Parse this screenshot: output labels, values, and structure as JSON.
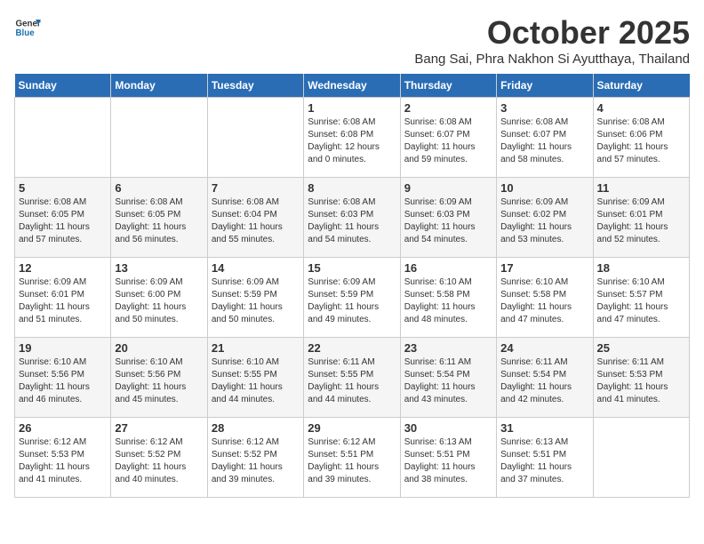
{
  "header": {
    "logo_general": "General",
    "logo_blue": "Blue",
    "month_title": "October 2025",
    "subtitle": "Bang Sai, Phra Nakhon Si Ayutthaya, Thailand"
  },
  "days_of_week": [
    "Sunday",
    "Monday",
    "Tuesday",
    "Wednesday",
    "Thursday",
    "Friday",
    "Saturday"
  ],
  "weeks": [
    [
      {
        "day": "",
        "info": ""
      },
      {
        "day": "",
        "info": ""
      },
      {
        "day": "",
        "info": ""
      },
      {
        "day": "1",
        "info": "Sunrise: 6:08 AM\nSunset: 6:08 PM\nDaylight: 12 hours\nand 0 minutes."
      },
      {
        "day": "2",
        "info": "Sunrise: 6:08 AM\nSunset: 6:07 PM\nDaylight: 11 hours\nand 59 minutes."
      },
      {
        "day": "3",
        "info": "Sunrise: 6:08 AM\nSunset: 6:07 PM\nDaylight: 11 hours\nand 58 minutes."
      },
      {
        "day": "4",
        "info": "Sunrise: 6:08 AM\nSunset: 6:06 PM\nDaylight: 11 hours\nand 57 minutes."
      }
    ],
    [
      {
        "day": "5",
        "info": "Sunrise: 6:08 AM\nSunset: 6:05 PM\nDaylight: 11 hours\nand 57 minutes."
      },
      {
        "day": "6",
        "info": "Sunrise: 6:08 AM\nSunset: 6:05 PM\nDaylight: 11 hours\nand 56 minutes."
      },
      {
        "day": "7",
        "info": "Sunrise: 6:08 AM\nSunset: 6:04 PM\nDaylight: 11 hours\nand 55 minutes."
      },
      {
        "day": "8",
        "info": "Sunrise: 6:08 AM\nSunset: 6:03 PM\nDaylight: 11 hours\nand 54 minutes."
      },
      {
        "day": "9",
        "info": "Sunrise: 6:09 AM\nSunset: 6:03 PM\nDaylight: 11 hours\nand 54 minutes."
      },
      {
        "day": "10",
        "info": "Sunrise: 6:09 AM\nSunset: 6:02 PM\nDaylight: 11 hours\nand 53 minutes."
      },
      {
        "day": "11",
        "info": "Sunrise: 6:09 AM\nSunset: 6:01 PM\nDaylight: 11 hours\nand 52 minutes."
      }
    ],
    [
      {
        "day": "12",
        "info": "Sunrise: 6:09 AM\nSunset: 6:01 PM\nDaylight: 11 hours\nand 51 minutes."
      },
      {
        "day": "13",
        "info": "Sunrise: 6:09 AM\nSunset: 6:00 PM\nDaylight: 11 hours\nand 50 minutes."
      },
      {
        "day": "14",
        "info": "Sunrise: 6:09 AM\nSunset: 5:59 PM\nDaylight: 11 hours\nand 50 minutes."
      },
      {
        "day": "15",
        "info": "Sunrise: 6:09 AM\nSunset: 5:59 PM\nDaylight: 11 hours\nand 49 minutes."
      },
      {
        "day": "16",
        "info": "Sunrise: 6:10 AM\nSunset: 5:58 PM\nDaylight: 11 hours\nand 48 minutes."
      },
      {
        "day": "17",
        "info": "Sunrise: 6:10 AM\nSunset: 5:58 PM\nDaylight: 11 hours\nand 47 minutes."
      },
      {
        "day": "18",
        "info": "Sunrise: 6:10 AM\nSunset: 5:57 PM\nDaylight: 11 hours\nand 47 minutes."
      }
    ],
    [
      {
        "day": "19",
        "info": "Sunrise: 6:10 AM\nSunset: 5:56 PM\nDaylight: 11 hours\nand 46 minutes."
      },
      {
        "day": "20",
        "info": "Sunrise: 6:10 AM\nSunset: 5:56 PM\nDaylight: 11 hours\nand 45 minutes."
      },
      {
        "day": "21",
        "info": "Sunrise: 6:10 AM\nSunset: 5:55 PM\nDaylight: 11 hours\nand 44 minutes."
      },
      {
        "day": "22",
        "info": "Sunrise: 6:11 AM\nSunset: 5:55 PM\nDaylight: 11 hours\nand 44 minutes."
      },
      {
        "day": "23",
        "info": "Sunrise: 6:11 AM\nSunset: 5:54 PM\nDaylight: 11 hours\nand 43 minutes."
      },
      {
        "day": "24",
        "info": "Sunrise: 6:11 AM\nSunset: 5:54 PM\nDaylight: 11 hours\nand 42 minutes."
      },
      {
        "day": "25",
        "info": "Sunrise: 6:11 AM\nSunset: 5:53 PM\nDaylight: 11 hours\nand 41 minutes."
      }
    ],
    [
      {
        "day": "26",
        "info": "Sunrise: 6:12 AM\nSunset: 5:53 PM\nDaylight: 11 hours\nand 41 minutes."
      },
      {
        "day": "27",
        "info": "Sunrise: 6:12 AM\nSunset: 5:52 PM\nDaylight: 11 hours\nand 40 minutes."
      },
      {
        "day": "28",
        "info": "Sunrise: 6:12 AM\nSunset: 5:52 PM\nDaylight: 11 hours\nand 39 minutes."
      },
      {
        "day": "29",
        "info": "Sunrise: 6:12 AM\nSunset: 5:51 PM\nDaylight: 11 hours\nand 39 minutes."
      },
      {
        "day": "30",
        "info": "Sunrise: 6:13 AM\nSunset: 5:51 PM\nDaylight: 11 hours\nand 38 minutes."
      },
      {
        "day": "31",
        "info": "Sunrise: 6:13 AM\nSunset: 5:51 PM\nDaylight: 11 hours\nand 37 minutes."
      },
      {
        "day": "",
        "info": ""
      }
    ]
  ]
}
